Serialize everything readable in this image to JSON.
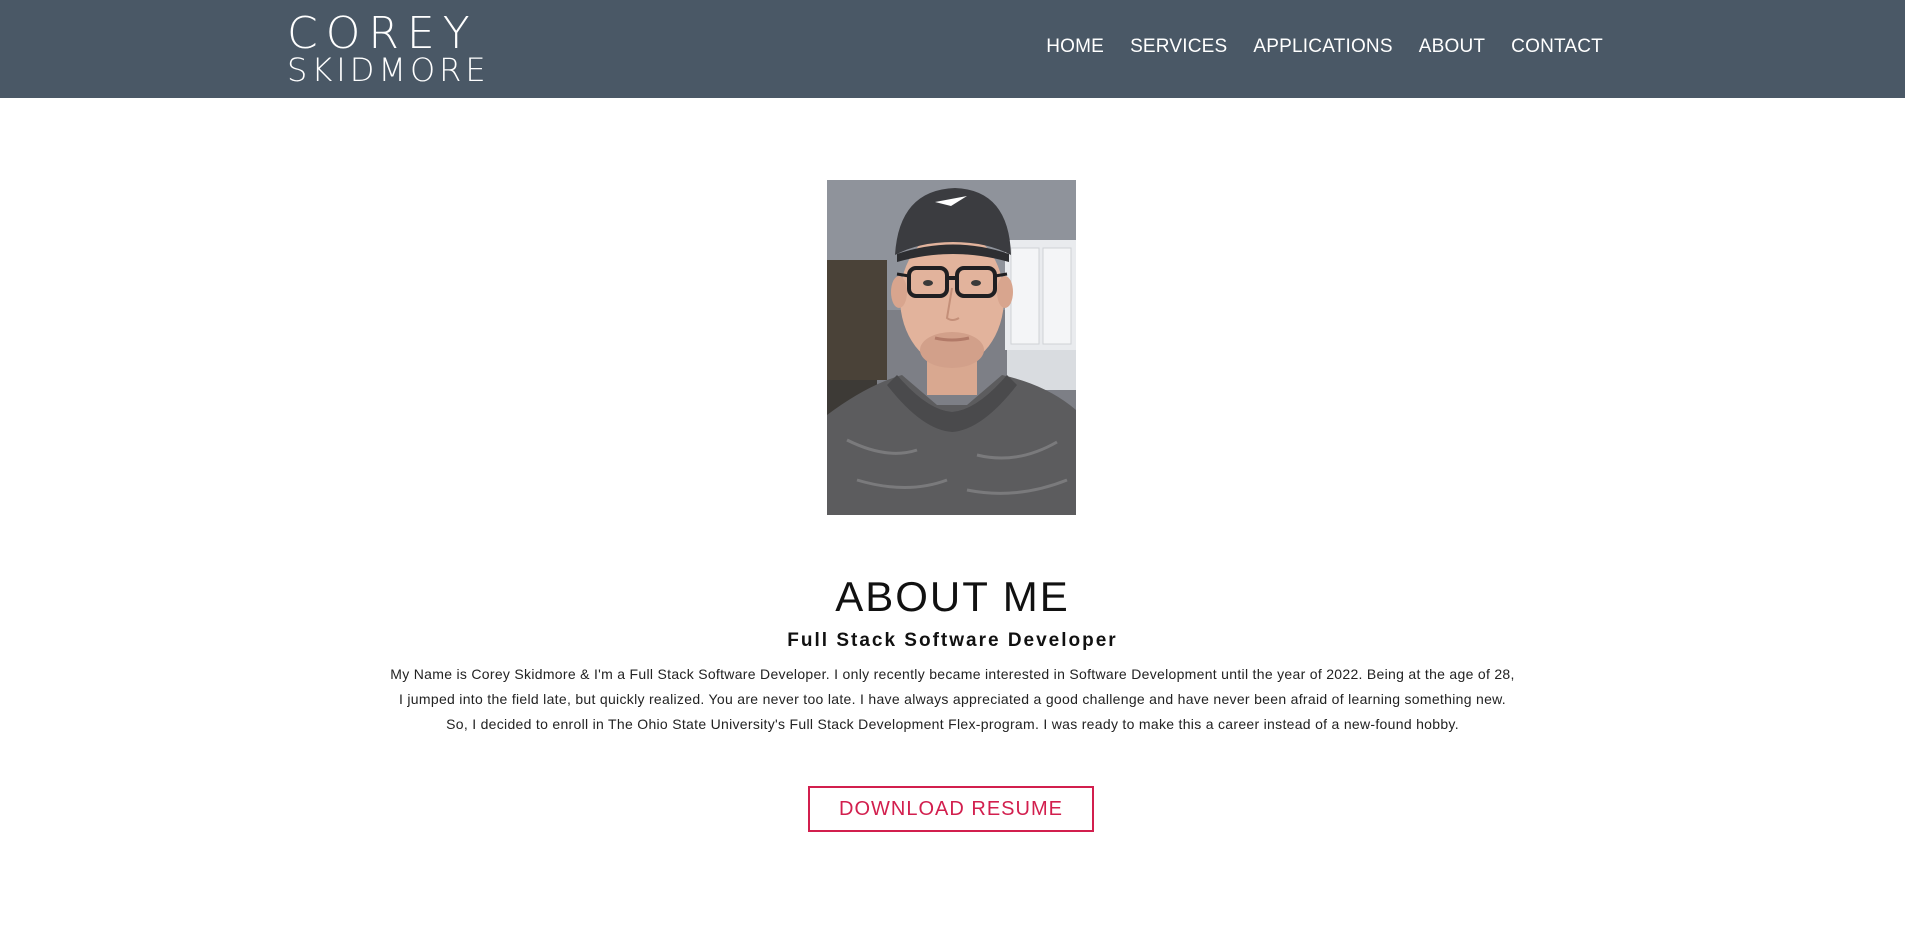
{
  "header": {
    "logo_line1": "COREY",
    "logo_line2": "SKIDMORE",
    "nav": [
      {
        "label": "HOME"
      },
      {
        "label": "SERVICES"
      },
      {
        "label": "APPLICATIONS"
      },
      {
        "label": "ABOUT"
      },
      {
        "label": "CONTACT"
      }
    ]
  },
  "about": {
    "title": "ABOUT ME",
    "subtitle": "Full Stack Software Developer",
    "bio_lines": [
      "My Name is Corey Skidmore & I'm a Full Stack Software Developer. I only recently became interested in Software Development until the year of 2022. Being at the age of 28,",
      "I jumped into the field late, but quickly realized. You are never too late. I have always appreciated a good challenge and have never been afraid of learning something new.",
      "So, I decided to enroll in The Ohio State University's Full Stack Development Flex-program. I was ready to make this a career instead of a new-found hobby."
    ],
    "button_label": "DOWNLOAD RESUME"
  },
  "colors": {
    "navbar_bg": "#4a5866",
    "accent": "#d21f4e"
  }
}
